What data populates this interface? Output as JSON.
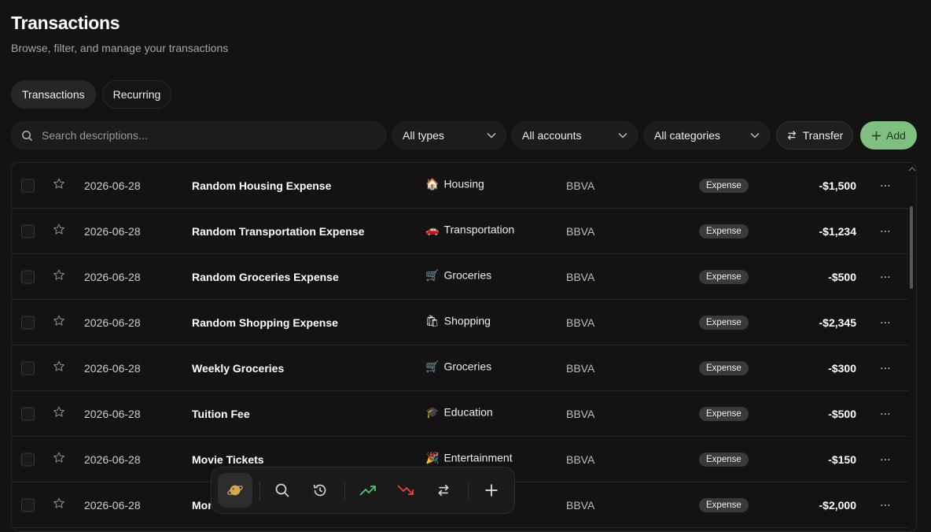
{
  "header": {
    "title": "Transactions",
    "subtitle": "Browse, filter, and manage your transactions"
  },
  "tabs": [
    {
      "label": "Transactions",
      "active": true
    },
    {
      "label": "Recurring",
      "active": false
    }
  ],
  "toolbar": {
    "search_placeholder": "Search descriptions...",
    "type_filter": "All types",
    "account_filter": "All accounts",
    "category_filter": "All categories",
    "transfer_label": "Transfer",
    "add_label": "Add"
  },
  "colors": {
    "background": "#131313",
    "add_button": "#7fbf7f",
    "income_arrow": "#3ecf72",
    "expense_arrow": "#e0453a"
  },
  "transactions": [
    {
      "date": "2026-06-28",
      "description": "Random Housing Expense",
      "category_icon": "🏠",
      "category": "Housing",
      "account": "BBVA",
      "type": "Expense",
      "amount": "-$1,500"
    },
    {
      "date": "2026-06-28",
      "description": "Random Transportation Expense",
      "category_icon": "🚗",
      "category": "Transportation",
      "account": "BBVA",
      "type": "Expense",
      "amount": "-$1,234"
    },
    {
      "date": "2026-06-28",
      "description": "Random Groceries Expense",
      "category_icon": "🛒",
      "category": "Groceries",
      "account": "BBVA",
      "type": "Expense",
      "amount": "-$500"
    },
    {
      "date": "2026-06-28",
      "description": "Random Shopping Expense",
      "category_icon": "🛍",
      "category": "Shopping",
      "account": "BBVA",
      "type": "Expense",
      "amount": "-$2,345"
    },
    {
      "date": "2026-06-28",
      "description": "Weekly Groceries",
      "category_icon": "🛒",
      "category": "Groceries",
      "account": "BBVA",
      "type": "Expense",
      "amount": "-$300"
    },
    {
      "date": "2026-06-28",
      "description": "Tuition Fee",
      "category_icon": "🎓",
      "category": "Education",
      "account": "BBVA",
      "type": "Expense",
      "amount": "-$500"
    },
    {
      "date": "2026-06-28",
      "description": "Movie Tickets",
      "category_icon": "🎉",
      "category": "Entertainment",
      "account": "BBVA",
      "type": "Expense",
      "amount": "-$150"
    },
    {
      "date": "2026-06-28",
      "description": "Mor",
      "category_icon": "",
      "category": "",
      "account": "BBVA",
      "type": "Expense",
      "amount": "-$2,000"
    }
  ],
  "dock": {
    "items": [
      "home-icon",
      "search-icon",
      "history-icon",
      "income-trend-icon",
      "expense-trend-icon",
      "transfer-icon",
      "add-icon"
    ]
  }
}
